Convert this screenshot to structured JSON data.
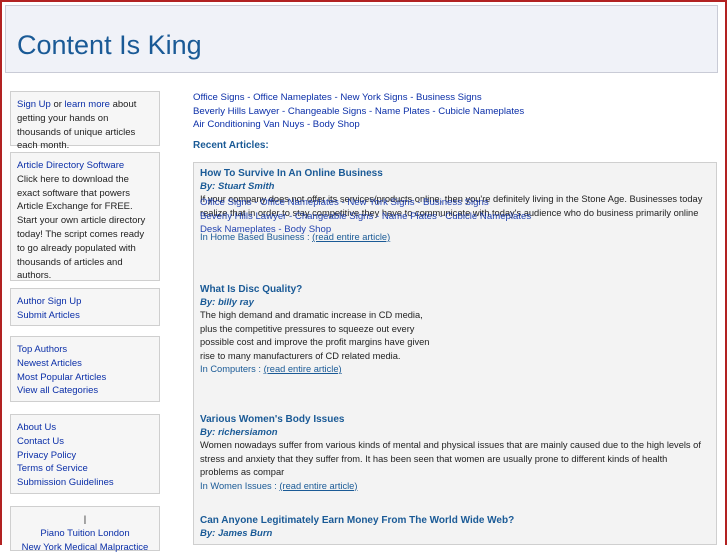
{
  "site_title": "Content Is King",
  "sidebar": {
    "signup": {
      "link1": "Sign Up",
      "or": "or",
      "link2": "learn more",
      "rest": "about getting your hands on thousands of unique articles each month."
    },
    "software": {
      "title": "Article Directory Software",
      "text": "Click here to download the exact software that powers Article Exchange for FREE. Start your own article directory today! The script comes ready to go already populated with thousands of articles and authors."
    },
    "author_links": [
      "Author Sign Up",
      "Submit Articles"
    ],
    "nav_links": [
      "Top Authors",
      "Newest Articles",
      "Most Popular Articles",
      "View all Categories"
    ],
    "info_links": [
      "About Us",
      "Contact Us",
      "Privacy Policy",
      "Terms of Service",
      "Submission Guidelines"
    ],
    "bottom": {
      "sep": "|",
      "link1": "Piano Tuition London",
      "link2": "New York Medical Malpractice"
    }
  },
  "top_links": {
    "line1": "Office Signs - Office Nameplates - New York Signs - Business Signs",
    "line2": "Beverly Hills Lawyer - Changeable Signs - Name Plates - Cubicle Nameplates",
    "line3": "Air Conditioning Van Nuys - Body Shop"
  },
  "recent_heading": "Recent Articles:",
  "overlay_links": {
    "line1": "Office Signs - Office Nameplates - New York Signs - Business Signs",
    "line2": "Beverly Hills Lawyer - Changeable Signs - Name Plates - Cubicle Nameplates",
    "line3": "Desk Nameplates - Body Shop"
  },
  "articles": [
    {
      "title": "How To Survive In An Online Business",
      "author": "By: Stuart Smith",
      "summary": "If your company does not offer its services/products online, then you're definitely living in the Stone Age. Businesses today realize that in order to stay competitive they have to communicate with today's audience who do business primarily online",
      "category": "In Home Based Business :",
      "read_more": "(read entire article)"
    },
    {
      "title": "What Is Disc Quality?",
      "author": "By: billy ray",
      "summary": "The high demand and dramatic increase in CD media, plus the competitive pressures to squeeze out every possible cost and improve the profit margins have given rise to many manufacturers of CD related media.",
      "category": "In Computers :",
      "read_more": "(read entire article)"
    },
    {
      "title": "Various Women's Body Issues",
      "author": "By: richersiamon",
      "summary": "Women nowadays suffer from various kinds of mental and physical issues that are mainly caused due to the high levels of stress and anxiety that they suffer from. It has been seen that women are usually prone to different kinds of health problems as compar",
      "category": "In Women Issues :",
      "read_more": "(read entire article)"
    },
    {
      "title": "Can Anyone Legitimately Earn Money From The World Wide Web?",
      "author": "By: James Burn"
    }
  ]
}
